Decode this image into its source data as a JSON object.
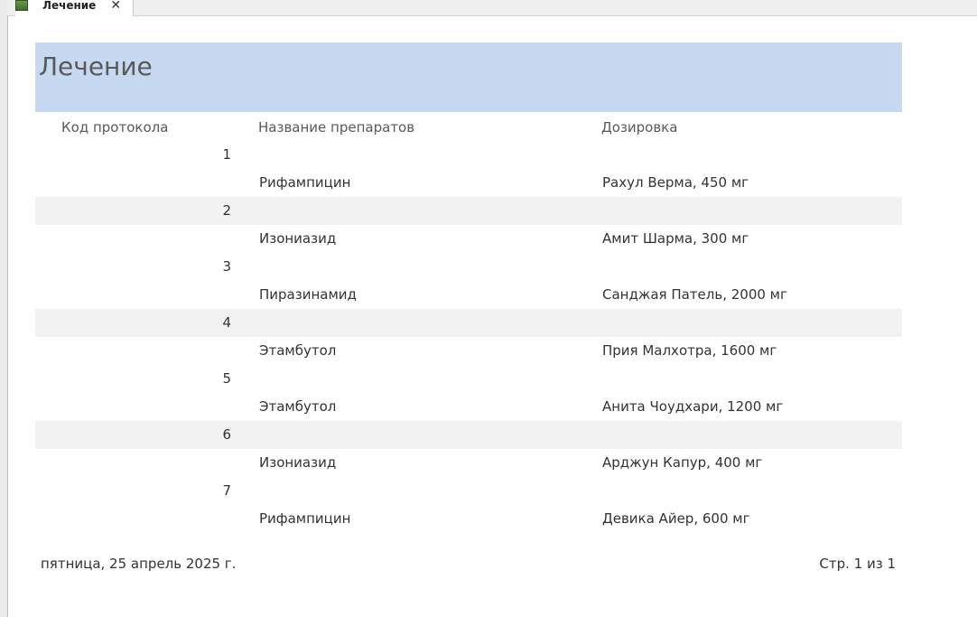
{
  "tab": {
    "label": "Лечение",
    "close": "✕"
  },
  "report": {
    "title": "Лечение",
    "headers": {
      "code": "Код протокола",
      "name": "Название препаратов",
      "dose": "Дозировка"
    },
    "groups": [
      {
        "code": "1",
        "drug": "Рифампицин",
        "dose": "Рахул Верма, 450 мг"
      },
      {
        "code": "2",
        "drug": "Изониазид",
        "dose": "Амит Шарма, 300 мг"
      },
      {
        "code": "3",
        "drug": "Пиразинамид",
        "dose": "Санджая Патель, 2000 мг"
      },
      {
        "code": "4",
        "drug": "Этамбутол",
        "dose": "Прия Малхотра, 1600 мг"
      },
      {
        "code": "5",
        "drug": "Этамбутол",
        "dose": "Анита Чоудхари, 1200 мг"
      },
      {
        "code": "6",
        "drug": "Изониазид",
        "dose": "Арджун Капур, 400 мг"
      },
      {
        "code": "7",
        "drug": "Рифампицин",
        "dose": "Девика Айер, 600 мг"
      }
    ],
    "footer": {
      "date": "пятница, 25 апрель 2025 г.",
      "page": "Стр. 1 из 1"
    }
  },
  "colors": {
    "header_band": "#c6d9f1",
    "shaded_row": "#f2f2f2"
  },
  "icons": {
    "tab_icon": "report-icon"
  }
}
